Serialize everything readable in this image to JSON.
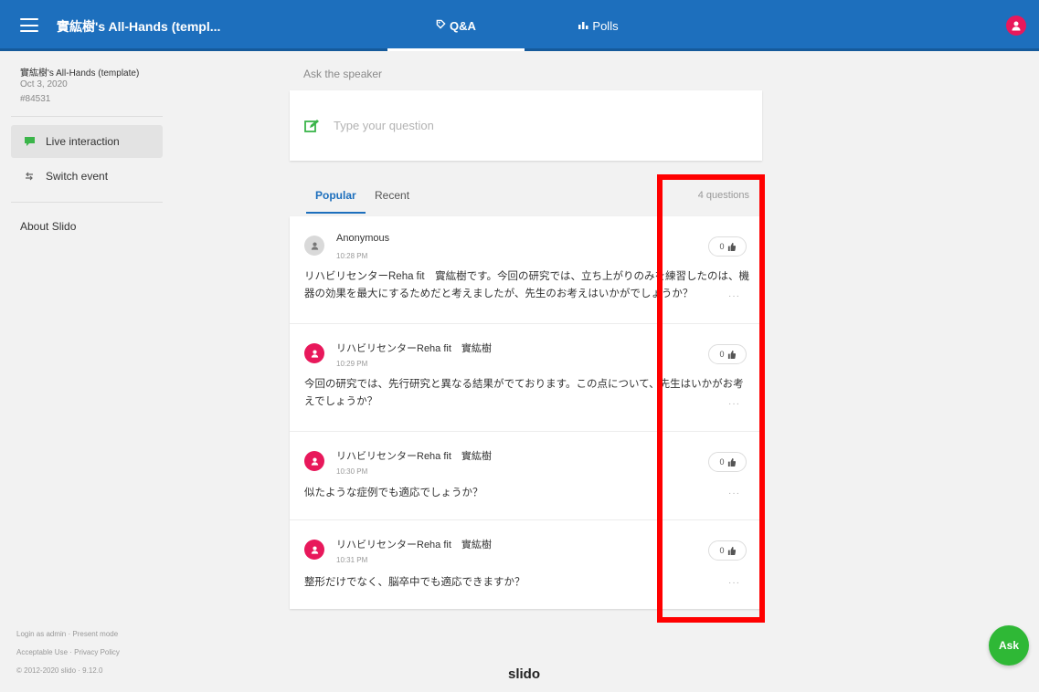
{
  "header": {
    "event_title": "實紘樹's All-Hands (templ...",
    "tabs": [
      {
        "label": "Q&A",
        "active": true
      },
      {
        "label": "Polls",
        "active": false
      }
    ]
  },
  "sidebar": {
    "event_name": "實紘樹's All-Hands (template)",
    "event_date": "Oct 3, 2020",
    "event_code": "#84531",
    "nav": [
      {
        "label": "Live interaction",
        "active": true,
        "icon": "live-chat-icon"
      },
      {
        "label": "Switch event",
        "active": false,
        "icon": "switch-arrows-icon"
      }
    ],
    "about": "About Slido",
    "footer": {
      "line1": "Login as admin · Present mode",
      "line2": "Acceptable Use · Privacy Policy",
      "line3": "© 2012-2020 slido · 9.12.0"
    }
  },
  "ask": {
    "label": "Ask the speaker",
    "placeholder": "Type your question"
  },
  "question_tabs": {
    "popular": "Popular",
    "recent": "Recent",
    "count": "4 questions"
  },
  "questions": [
    {
      "author": "Anonymous",
      "anonymous": true,
      "time": "10:28 PM",
      "text": "リハビリセンターReha fit　實紘樹です。今回の研究では、立ち上がりのみを練習したのは、機器の効果を最大にするためだと考えましたが、先生のお考えはいかがでしょうか？",
      "likes": "0"
    },
    {
      "author": "リハビリセンターReha fit　實紘樹",
      "anonymous": false,
      "time": "10:29 PM",
      "text": "今回の研究では、先行研究と異なる結果がでております。この点について、先生はいかがお考えでしょうか？",
      "likes": "0"
    },
    {
      "author": "リハビリセンターReha fit　實紘樹",
      "anonymous": false,
      "time": "10:30 PM",
      "text": "似たような症例でも適応でしょうか？",
      "likes": "0"
    },
    {
      "author": "リハビリセンターReha fit　實紘樹",
      "anonymous": false,
      "time": "10:31 PM",
      "text": "整形だけでなく、脳卒中でも適応できますか？",
      "likes": "0"
    }
  ],
  "brand": "slido",
  "fab_label": "Ask",
  "colors": {
    "header": "#1d6fbd",
    "accent": "#1d6fbd",
    "avatar": "#e8185b",
    "ask_button": "#2fb836",
    "pen_icon": "#3bb54a",
    "highlight": "#ff0000"
  }
}
